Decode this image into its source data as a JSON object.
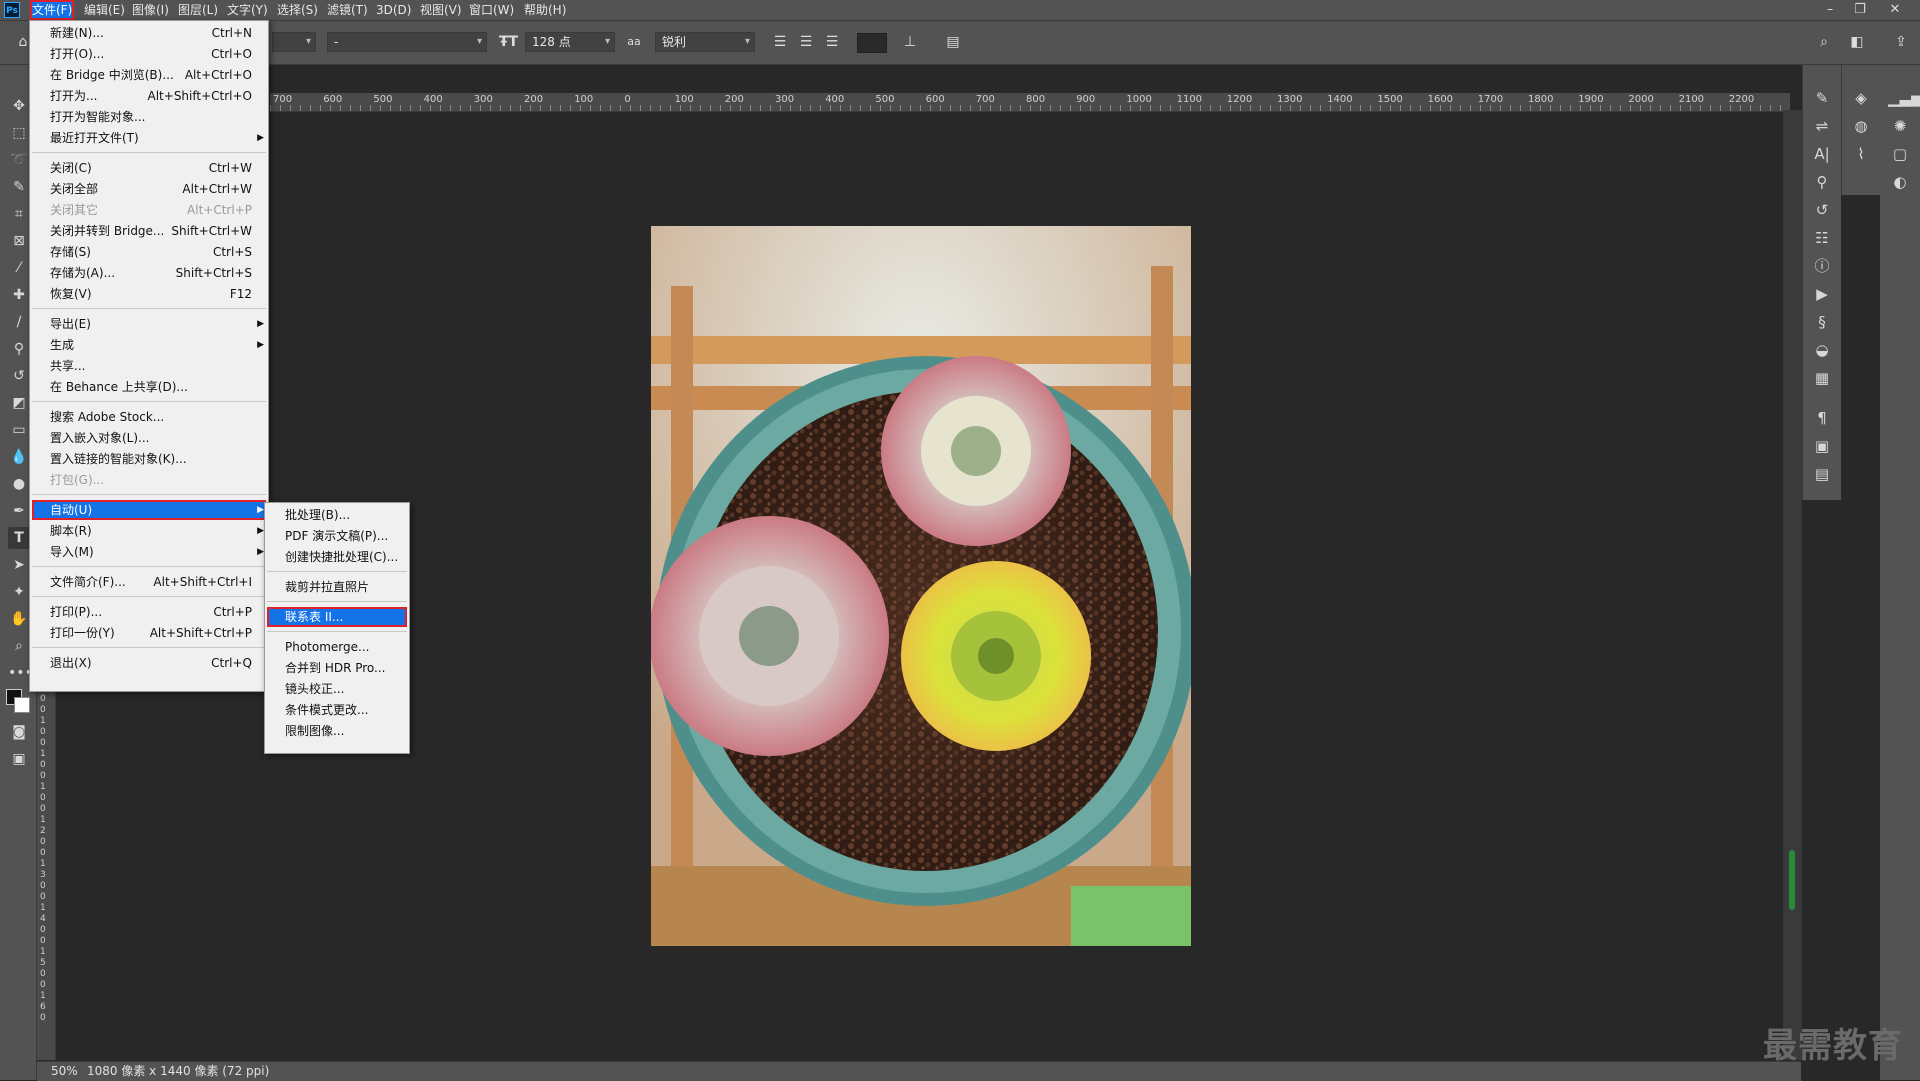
{
  "app": {
    "logo": "Ps"
  },
  "menubar": {
    "items": [
      "文件(F)",
      "编辑(E)",
      "图像(I)",
      "图层(L)",
      "文字(Y)",
      "选择(S)",
      "滤镜(T)",
      "3D(D)",
      "视图(V)",
      "窗口(W)",
      "帮助(H)"
    ],
    "window_controls": [
      "minimize-icon",
      "restore-icon",
      "close-icon"
    ]
  },
  "optionsbar": {
    "font_style": "-",
    "font_size": "128 点",
    "antialias_icon": "aa",
    "antialias": "锐利",
    "text_color": "#2a2a2a"
  },
  "ruler": {
    "h_labels": [
      "700",
      "600",
      "500",
      "400",
      "300",
      "200",
      "100",
      "0",
      "100",
      "200",
      "300",
      "400",
      "500",
      "600",
      "700",
      "800",
      "900",
      "1000",
      "1100",
      "1200",
      "1300",
      "1400",
      "1500",
      "1600",
      "1700",
      "1800",
      "1900",
      "2000",
      "2100",
      "2200"
    ],
    "v_digits": [
      "0",
      "0",
      "1",
      "0",
      "0",
      "1",
      "0",
      "0",
      "1",
      "0",
      "0",
      "1",
      "2",
      "0",
      "0",
      "1",
      "3",
      "0",
      "0",
      "1",
      "4",
      "0",
      "0",
      "1",
      "5",
      "0",
      "0",
      "1",
      "6",
      "0"
    ]
  },
  "file_menu": {
    "items": [
      {
        "label": "新建(N)...",
        "shortcut": "Ctrl+N"
      },
      {
        "label": "打开(O)...",
        "shortcut": "Ctrl+O"
      },
      {
        "label": "在 Bridge 中浏览(B)...",
        "shortcut": "Alt+Ctrl+O"
      },
      {
        "label": "打开为...",
        "shortcut": "Alt+Shift+Ctrl+O"
      },
      {
        "label": "打开为智能对象...",
        "shortcut": ""
      },
      {
        "label": "最近打开文件(T)",
        "shortcut": "",
        "submenu": true
      },
      {
        "label": "关闭(C)",
        "shortcut": "Ctrl+W",
        "sep_before": true
      },
      {
        "label": "关闭全部",
        "shortcut": "Alt+Ctrl+W"
      },
      {
        "label": "关闭其它",
        "shortcut": "Alt+Ctrl+P",
        "disabled": true
      },
      {
        "label": "关闭并转到 Bridge...",
        "shortcut": "Shift+Ctrl+W"
      },
      {
        "label": "存储(S)",
        "shortcut": "Ctrl+S"
      },
      {
        "label": "存储为(A)...",
        "shortcut": "Shift+Ctrl+S"
      },
      {
        "label": "恢复(V)",
        "shortcut": "F12"
      },
      {
        "label": "导出(E)",
        "shortcut": "",
        "submenu": true,
        "sep_before": true
      },
      {
        "label": "生成",
        "shortcut": "",
        "submenu": true
      },
      {
        "label": "共享...",
        "shortcut": ""
      },
      {
        "label": "在 Behance 上共享(D)...",
        "shortcut": ""
      },
      {
        "label": "搜索 Adobe Stock...",
        "shortcut": "",
        "sep_before": true
      },
      {
        "label": "置入嵌入对象(L)...",
        "shortcut": ""
      },
      {
        "label": "置入链接的智能对象(K)...",
        "shortcut": ""
      },
      {
        "label": "打包(G)...",
        "shortcut": "",
        "disabled": true
      },
      {
        "label": "自动(U)",
        "shortcut": "",
        "submenu": true,
        "sep_before": true,
        "highlighted": true
      },
      {
        "label": "脚本(R)",
        "shortcut": "",
        "submenu": true
      },
      {
        "label": "导入(M)",
        "shortcut": "",
        "submenu": true
      },
      {
        "label": "文件简介(F)...",
        "shortcut": "Alt+Shift+Ctrl+I",
        "sep_before": true
      },
      {
        "label": "打印(P)...",
        "shortcut": "Ctrl+P",
        "sep_before": true
      },
      {
        "label": "打印一份(Y)",
        "shortcut": "Alt+Shift+Ctrl+P"
      },
      {
        "label": "退出(X)",
        "shortcut": "Ctrl+Q",
        "sep_before": true
      }
    ]
  },
  "automate_menu": {
    "items": [
      {
        "label": "批处理(B)..."
      },
      {
        "label": "PDF 演示文稿(P)..."
      },
      {
        "label": "创建快捷批处理(C)..."
      },
      {
        "label": "裁剪并拉直照片",
        "sep_before": true
      },
      {
        "label": "联系表 II...",
        "sep_before": true,
        "highlighted": true
      },
      {
        "label": "Photomerge...",
        "sep_before": true
      },
      {
        "label": "合并到 HDR Pro..."
      },
      {
        "label": "镜头校正..."
      },
      {
        "label": "条件模式更改..."
      },
      {
        "label": "限制图像..."
      }
    ]
  },
  "status": {
    "zoom": "50%",
    "doc_info": "1080 像素 x 1440 像素 (72 ppi)"
  },
  "watermark": "最需教育",
  "colors": {
    "highlight": "#1473e6",
    "highlight_border": "#e0202a",
    "ui_panel": "#535353",
    "workspace": "#282828"
  }
}
